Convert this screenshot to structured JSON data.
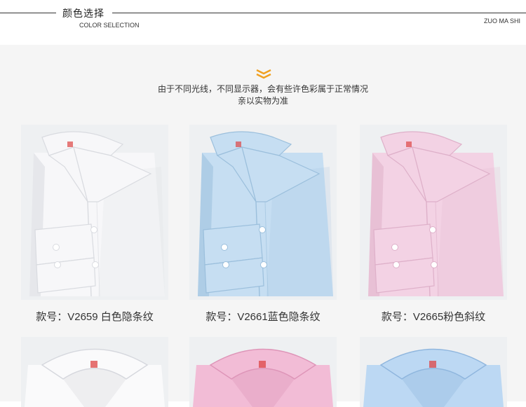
{
  "header": {
    "title_cn": "颜色选择",
    "title_en": "COLOR SELECTION",
    "brand": "ZUO MA SHI"
  },
  "notice": {
    "line1": "由于不同光线，不同显示器，会有些许色彩属于正常情况",
    "line2": "亲以实物为准"
  },
  "colors": {
    "accent": "#f0a020",
    "background": "#f5f5f5"
  },
  "products": [
    {
      "caption": "款号：V2659 白色隐条纹",
      "shirt_color": "#f7f7f9",
      "shade": "#d9dbe0"
    },
    {
      "caption": "款号：V2661蓝色隐条纹",
      "shirt_color": "#c6def2",
      "shade": "#9bbfdc"
    },
    {
      "caption": "款号：V2665粉色斜纹",
      "shirt_color": "#f3d2e4",
      "shade": "#deb0c9"
    }
  ],
  "products_row2": [
    {
      "shirt_color": "#fafafb",
      "shade": "#d6d8de"
    },
    {
      "shirt_color": "#f2bcd6",
      "shade": "#de95b8"
    },
    {
      "shirt_color": "#bcd8f3",
      "shade": "#8fb6de"
    }
  ]
}
